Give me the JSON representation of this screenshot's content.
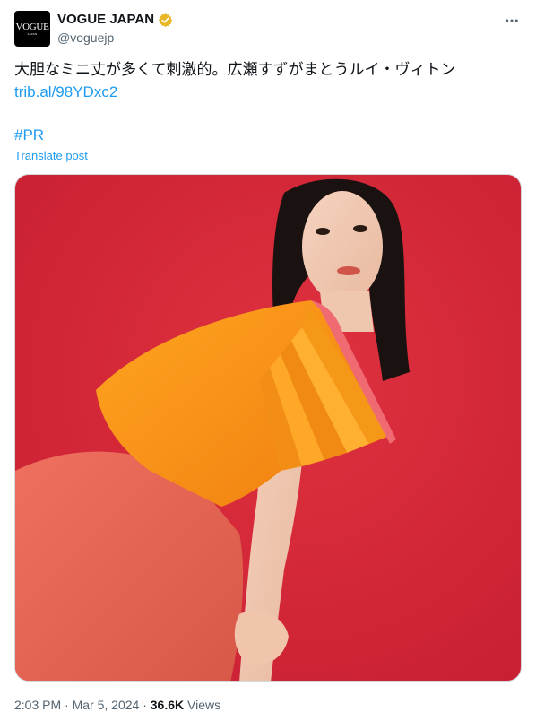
{
  "author": {
    "avatar_logo": "VOGUE",
    "avatar_sub": "JAPAN",
    "display_name": "VOGUE JAPAN",
    "handle": "@voguejp",
    "verified": true,
    "verified_icon": "gold-verified-badge-icon",
    "verified_color": "#e8b829"
  },
  "tweet": {
    "text": "大胆なミニ丈が多くて刺激的。広瀬すずがまとうルイ・ヴィトン",
    "link": "trib.al/98YDxc2",
    "hashtag": "#PR",
    "translate_label": "Translate post"
  },
  "media": {
    "alt_description": "Woman in orange pleated top and pink mini skirt against red background",
    "background_color": "#d22638"
  },
  "meta": {
    "time": "2:03 PM",
    "separator": "·",
    "date": "Mar 5, 2024",
    "views_count": "36.6K",
    "views_label": "Views"
  },
  "colors": {
    "accent": "#1d9bf0",
    "secondary_text": "#536471",
    "primary_text": "#0f1419"
  }
}
